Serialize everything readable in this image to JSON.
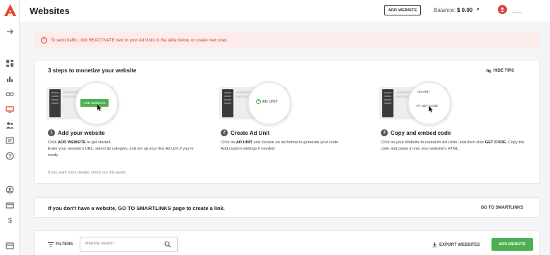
{
  "header": {
    "title": "Websites",
    "add_website_label": "ADD WEBSITE",
    "balance_label": "Balance:",
    "balance_value": "$ 0.00",
    "user_name": "rravuste"
  },
  "alert": {
    "text": "To send traffic, click REACTIVATE next to your Ad Units in the table below, or create new ones",
    "color": "#d23c32"
  },
  "steps": {
    "title": "3 steps to monetize your website",
    "hide_tips_label": "HIDE TIPS",
    "items": [
      {
        "number": "1",
        "title": "Add your website",
        "line1_pre": "Click ",
        "line1_bold": "ADD WEBSITE",
        "line1_post": " to get started.",
        "line2": "Enter your website's URL, select its category, and set up your first Ad Unit if you're ready.",
        "illustration_label": "ADD WEBSITE"
      },
      {
        "number": "2",
        "title": "Create Ad Unit",
        "line1_pre": "Click on ",
        "line1_bold": "AD UNIT",
        "line1_post": " and choose an ad format to generate your code.",
        "line2": "Add custom settings if needed.",
        "illustration_label": "AD UNIT"
      },
      {
        "number": "3",
        "title": "Copy and embed code",
        "line1_pre": "Click on your Website to reveal its Ad Units, and then click ",
        "line1_bold": "GET CODE",
        "line1_post": ". Copy the code and paste in into your website's HTML.",
        "line2": "",
        "illustration_top": "AD UNIT",
        "illustration_label": "GET CODE"
      }
    ],
    "guide_text": "If you want more details, check out this guide."
  },
  "smartlinks": {
    "text": "If you don't have a website, GO TO SMARTLINKS page to create a link.",
    "link_label": "GO TO SMARTLINKS"
  },
  "toolbar": {
    "filters_label": "FILTERS",
    "search_placeholder": "Website search",
    "export_label": "EXPORT WEBSITES",
    "add_website_label": "ADD WEBSITE"
  },
  "colors": {
    "accent": "#e8412c",
    "green": "#4caf50",
    "alert_bg": "#fdecec"
  },
  "sidebar": {
    "icons": [
      "expand-arrow-icon",
      "dashboard-icon",
      "statistics-icon",
      "smartlink-icon",
      "websites-icon",
      "referrals-icon",
      "payments-icon",
      "help-icon",
      "profile-icon",
      "billing-icon",
      "dollar-icon",
      "news-icon"
    ]
  }
}
